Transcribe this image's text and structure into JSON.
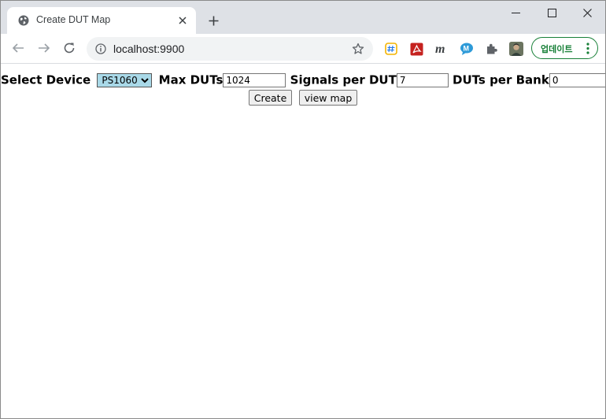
{
  "browser": {
    "tab_title": "Create DUT Map",
    "url": "localhost:9900",
    "update_label": "업데이트"
  },
  "form": {
    "device_label": "Select Device",
    "device_selected": "PS1060",
    "max_duts_label": "Max DUTs",
    "max_duts_value": "1024",
    "signals_label": "Signals per DUT",
    "signals_value": "7",
    "duts_per_bank_label": "DUTs per Bank",
    "duts_per_bank_value": "0",
    "create_label": "Create",
    "view_map_label": "view map"
  }
}
